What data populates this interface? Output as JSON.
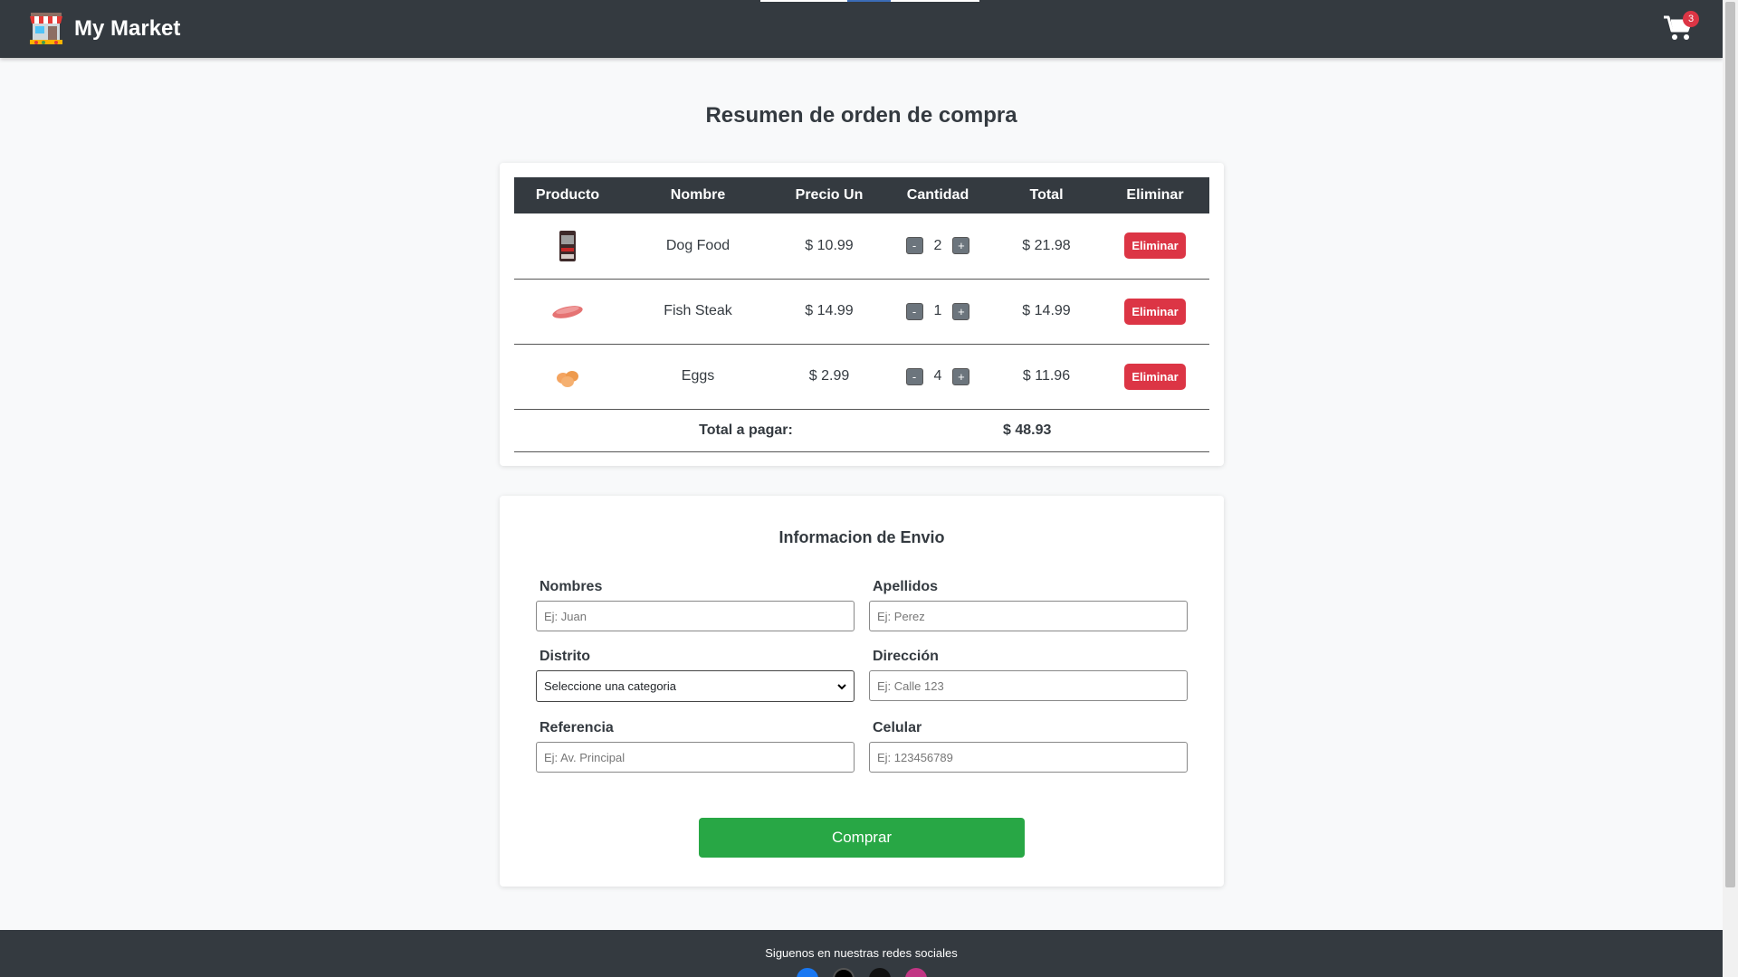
{
  "navbar": {
    "title": "My Market",
    "logo_icon": "market-stall-icon",
    "cart_icon": "cart-icon",
    "cart_count": "3"
  },
  "page": {
    "title": "Resumen de orden de compra"
  },
  "order": {
    "headers": [
      "Producto",
      "Nombre",
      "Precio Un",
      "Cantidad",
      "Total",
      "Eliminar"
    ],
    "items": [
      {
        "name": "Dog Food",
        "price": "$ 10.99",
        "qty": "2",
        "total": "$ 21.98",
        "delete": "Eliminar",
        "minus": "-",
        "plus": "+"
      },
      {
        "name": "Fish Steak",
        "price": "$ 14.99",
        "qty": "1",
        "total": "$ 14.99",
        "delete": "Eliminar",
        "minus": "-",
        "plus": "+"
      },
      {
        "name": "Eggs",
        "price": "$ 2.99",
        "qty": "4",
        "total": "$ 11.96",
        "delete": "Eliminar",
        "minus": "-",
        "plus": "+"
      }
    ],
    "total_label": "Total a pagar:",
    "total_value": "$ 48.93"
  },
  "shipping": {
    "title": "Informacion de Envio",
    "nombres": {
      "label": "Nombres",
      "placeholder": "Ej: Juan"
    },
    "apellidos": {
      "label": "Apellidos",
      "placeholder": "Ej: Perez"
    },
    "distrito": {
      "label": "Distrito",
      "value": "Seleccione una categoria"
    },
    "direccion": {
      "label": "Dirección",
      "placeholder": "Ej: Calle 123"
    },
    "referencia": {
      "label": "Referencia",
      "placeholder": "Ej: Av. Principal"
    },
    "celular": {
      "label": "Celular",
      "placeholder": "Ej: 123456789"
    },
    "buy_label": "Comprar"
  },
  "footer": {
    "text": "Siguenos en nuestras redes sociales",
    "socials": [
      "facebook-icon",
      "x-icon",
      "tiktok-icon",
      "instagram-icon"
    ]
  },
  "colors": {
    "navbar": "#343a40",
    "danger": "#dc3545",
    "success": "#28a745",
    "secondary": "#6c757d"
  }
}
